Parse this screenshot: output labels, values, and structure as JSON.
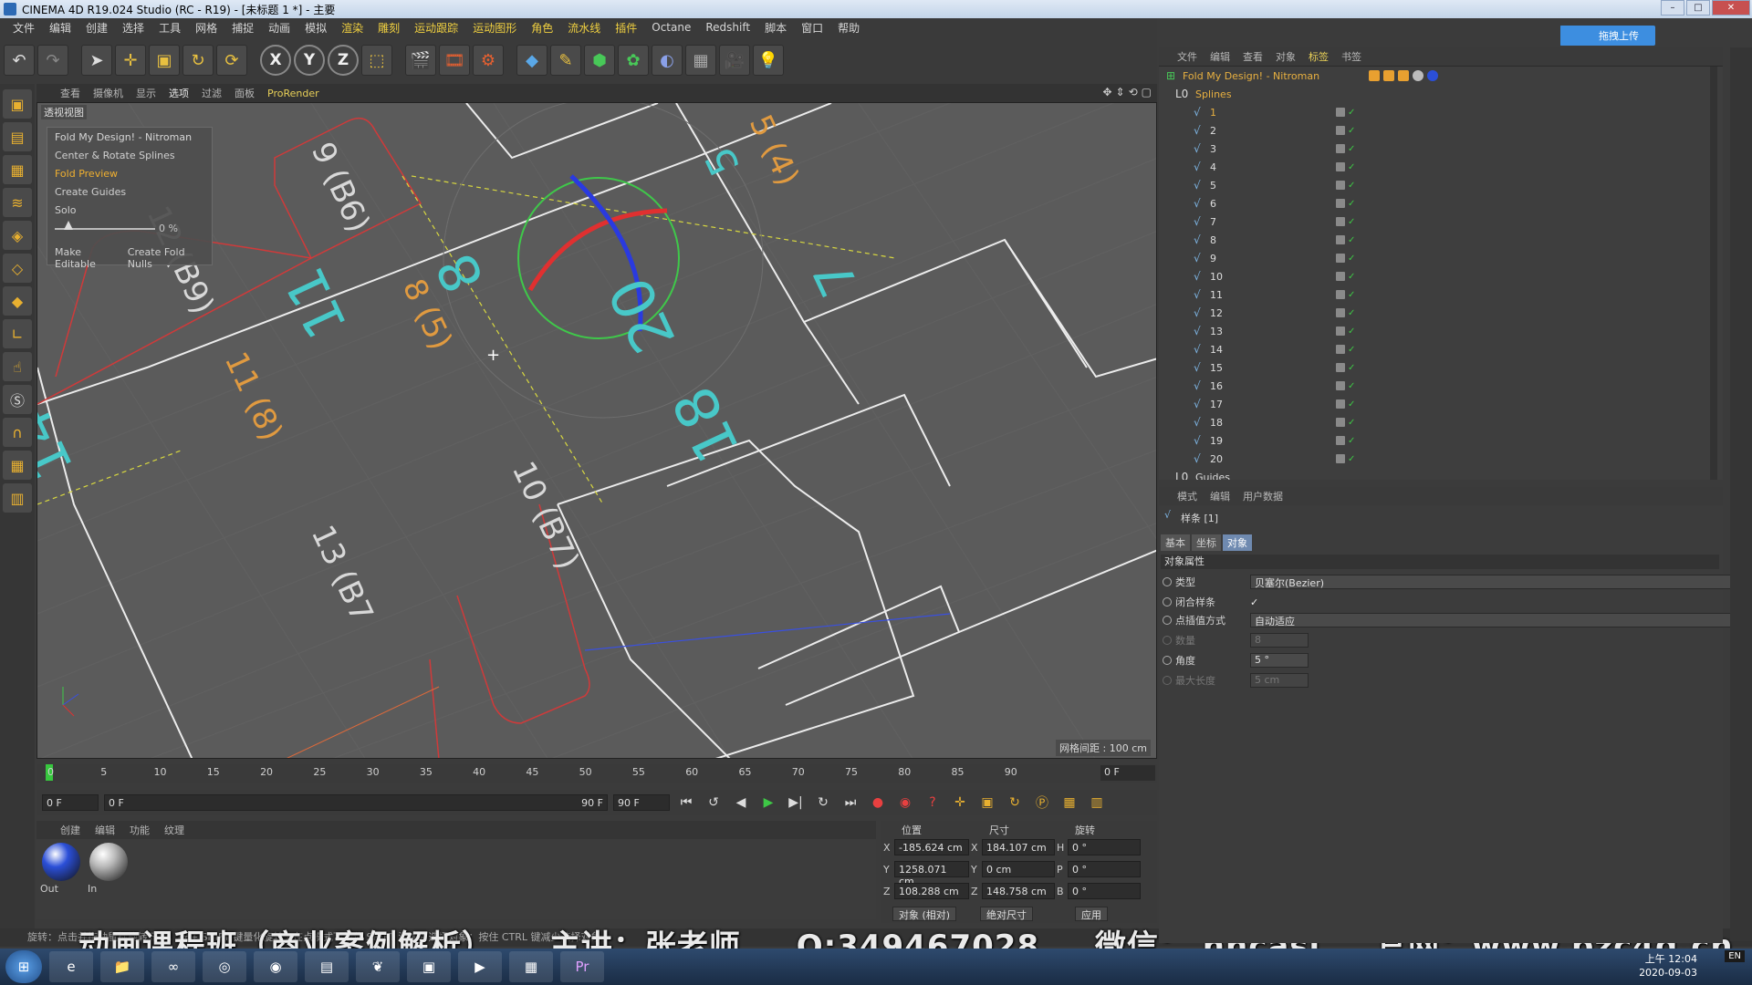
{
  "title": "CINEMA 4D R19.024 Studio (RC - R19) - [未标题 1 *] - 主要",
  "menu": [
    "文件",
    "编辑",
    "创建",
    "选择",
    "工具",
    "网格",
    "捕捉",
    "动画",
    "模拟",
    "渲染",
    "雕刻",
    "运动跟踪",
    "运动图形",
    "角色",
    "流水线",
    "插件",
    "Octane",
    "Redshift",
    "脚本",
    "窗口",
    "帮助"
  ],
  "cloud_upload": "拖拽上传",
  "viewport": {
    "menus": [
      "查看",
      "摄像机",
      "显示",
      "选项",
      "过滤",
      "面板",
      "ProRender"
    ],
    "label": "透视视图",
    "grid_spacing": "网格间距 : 100 cm",
    "plugin": {
      "title": "Fold My Design! - Nitroman",
      "center_rotate": "Center & Rotate Splines",
      "fold_preview": "Fold Preview",
      "create_guides": "Create Guides",
      "solo": "Solo",
      "percent": "0 %",
      "make_editable": "Make Editable",
      "create_fold_nulls": "Create Fold Nulls"
    },
    "labels": {
      "l9": "9 (B6)",
      "l12": "12 (B9)",
      "l8": "8 (5)",
      "l11": "11 (8)",
      "l10": "10 (B7)",
      "l13": "13 (B7",
      "l5": "5 (4)",
      "n11": "11",
      "n14": "14",
      "n8": "8",
      "n5": "5",
      "n7": "7",
      "n20": "20",
      "n18": "18"
    }
  },
  "timeline": {
    "ticks": [
      "0",
      "5",
      "10",
      "15",
      "20",
      "25",
      "30",
      "35",
      "40",
      "45",
      "50",
      "55",
      "60",
      "65",
      "70",
      "75",
      "80",
      "85",
      "90"
    ],
    "current": "0 F",
    "start": "0 F",
    "range_start": "0 F",
    "range_end": "90 F",
    "end": "90 F"
  },
  "materials": {
    "menus": [
      "创建",
      "编辑",
      "功能",
      "纹理"
    ],
    "items": [
      {
        "name": "Out",
        "color": "#2b4fd8"
      },
      {
        "name": "In",
        "color": "#b8b8b8"
      }
    ]
  },
  "coords": {
    "headers": {
      "pos": "位置",
      "size": "尺寸",
      "rot": "旋转"
    },
    "pos": {
      "x": "-185.624 cm",
      "y": "1258.071 cm",
      "z": "108.288 cm"
    },
    "size": {
      "x": "184.107 cm",
      "y": "0 cm",
      "z": "148.758 cm"
    },
    "rot": {
      "h": "0 °",
      "p": "0 °",
      "b": "0 °"
    },
    "mode1": "对象 (相对)",
    "mode2": "绝对尺寸",
    "apply": "应用"
  },
  "object_manager": {
    "menus": [
      "文件",
      "编辑",
      "查看",
      "对象",
      "标签",
      "书签"
    ],
    "root": "Fold My Design! - Nitroman",
    "splines": "Splines",
    "items": [
      "1",
      "2",
      "3",
      "4",
      "5",
      "6",
      "7",
      "8",
      "9",
      "10",
      "11",
      "12",
      "13",
      "14",
      "15",
      "16",
      "17",
      "18",
      "19",
      "20"
    ],
    "guides": "Guides"
  },
  "attribute_manager": {
    "menus": [
      "模式",
      "编辑",
      "用户数据"
    ],
    "object": "样条 [1]",
    "tabs": [
      "基本",
      "坐标",
      "对象"
    ],
    "section": "对象属性",
    "type_label": "类型",
    "type_value": "贝塞尔(Bezier)",
    "closed_label": "闭合样条",
    "interp_label": "点插值方式",
    "interp_value": "自动适应",
    "number_label": "数量",
    "number_value": "8",
    "angle_label": "角度",
    "angle_value": "5 °",
    "maxlen_label": "最大长度",
    "maxlen_value": "5 cm"
  },
  "status": "旋转：点击并拖动鼠标旋转元素。按住 SHIFT 键量化旋转 / 在点模式下按住 SHIFT 添加到选择对象；按住 CTRL 键减少选择对象。",
  "watermark": {
    "course": "动画课程班（商业案例解析）",
    "teacher": "主讲：张老师",
    "qq": "Q:349467028",
    "wechat": "微信： hhcasj",
    "site": "官网：www.bzc4d.cn"
  },
  "clock": {
    "time": "上午 12:04",
    "date": "2020-09-03"
  },
  "lang": "EN"
}
